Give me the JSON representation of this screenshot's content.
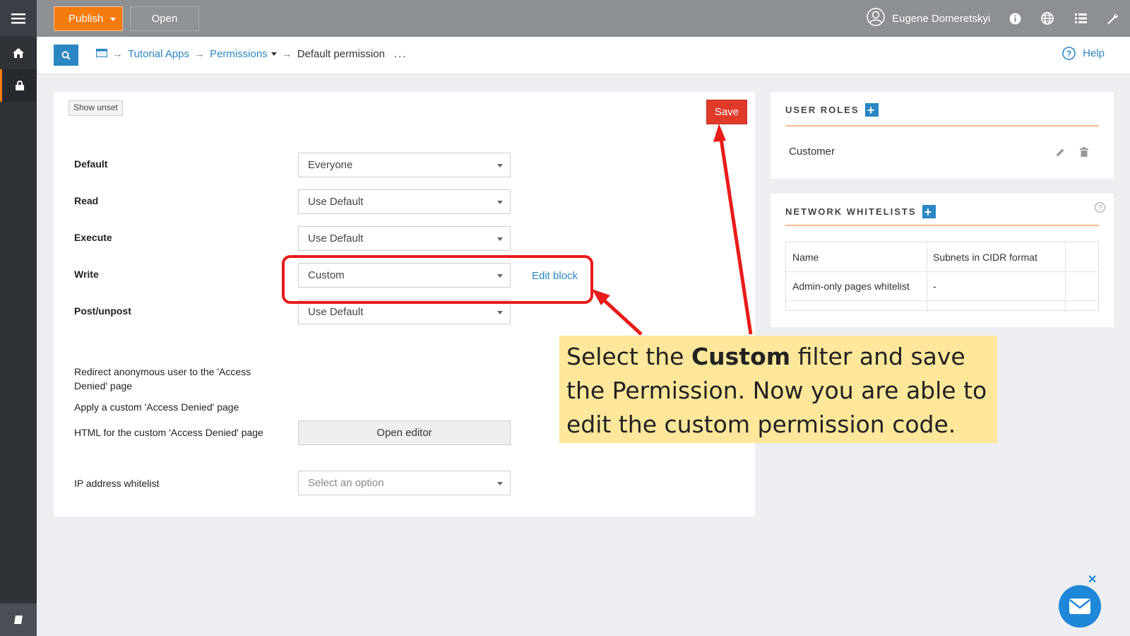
{
  "topbar": {
    "publish_label": "Publish",
    "open_label": "Open",
    "user_name": "Eugene Domeretskyi"
  },
  "breadcrumb": {
    "items": [
      "Tutorial Apps",
      "Permissions",
      "Default permission"
    ],
    "more": "..."
  },
  "help_label": "Help",
  "form": {
    "show_unset_label": "Show unset",
    "save_label": "Save",
    "rows": [
      {
        "label": "Default",
        "value": "Everyone"
      },
      {
        "label": "Read",
        "value": "Use Default"
      },
      {
        "label": "Execute",
        "value": "Use Default"
      },
      {
        "label": "Write",
        "value": "Custom"
      },
      {
        "label": "Post/unpost",
        "value": "Use Default"
      }
    ],
    "edit_block_label": "Edit block",
    "redirect_label": "Redirect anonymous user to the 'Access Denied' page",
    "apply_custom_label": "Apply a custom 'Access Denied' page",
    "html_label": "HTML for the custom 'Access Denied' page",
    "open_editor_label": "Open editor",
    "ip_label": "IP address whitelist",
    "ip_placeholder": "Select an option"
  },
  "user_roles": {
    "title": "USER ROLES",
    "roles": [
      "Customer"
    ]
  },
  "network_whitelists": {
    "title": "NETWORK WHITELISTS",
    "columns": [
      "Name",
      "Subnets in CIDR format"
    ],
    "rows": [
      [
        "Admin-only pages whitelist",
        "-"
      ]
    ]
  },
  "callout": {
    "part1": "Select the ",
    "bold": "Custom",
    "part2": " filter and save the Permission. Now you are able to edit the custom permission code."
  },
  "colors": {
    "accent": "#f47b0f",
    "link": "#2b87c3",
    "save": "#e03a2b",
    "annotation": "#ea1b1b",
    "callout_bg": "#fde79b"
  },
  "icons": {
    "sidebar": [
      "menu-icon",
      "home-icon",
      "lock-icon",
      "book-icon"
    ],
    "topbar": [
      "user-avatar-icon",
      "info-icon",
      "globe-icon",
      "list-icon",
      "wrench-icon"
    ]
  }
}
